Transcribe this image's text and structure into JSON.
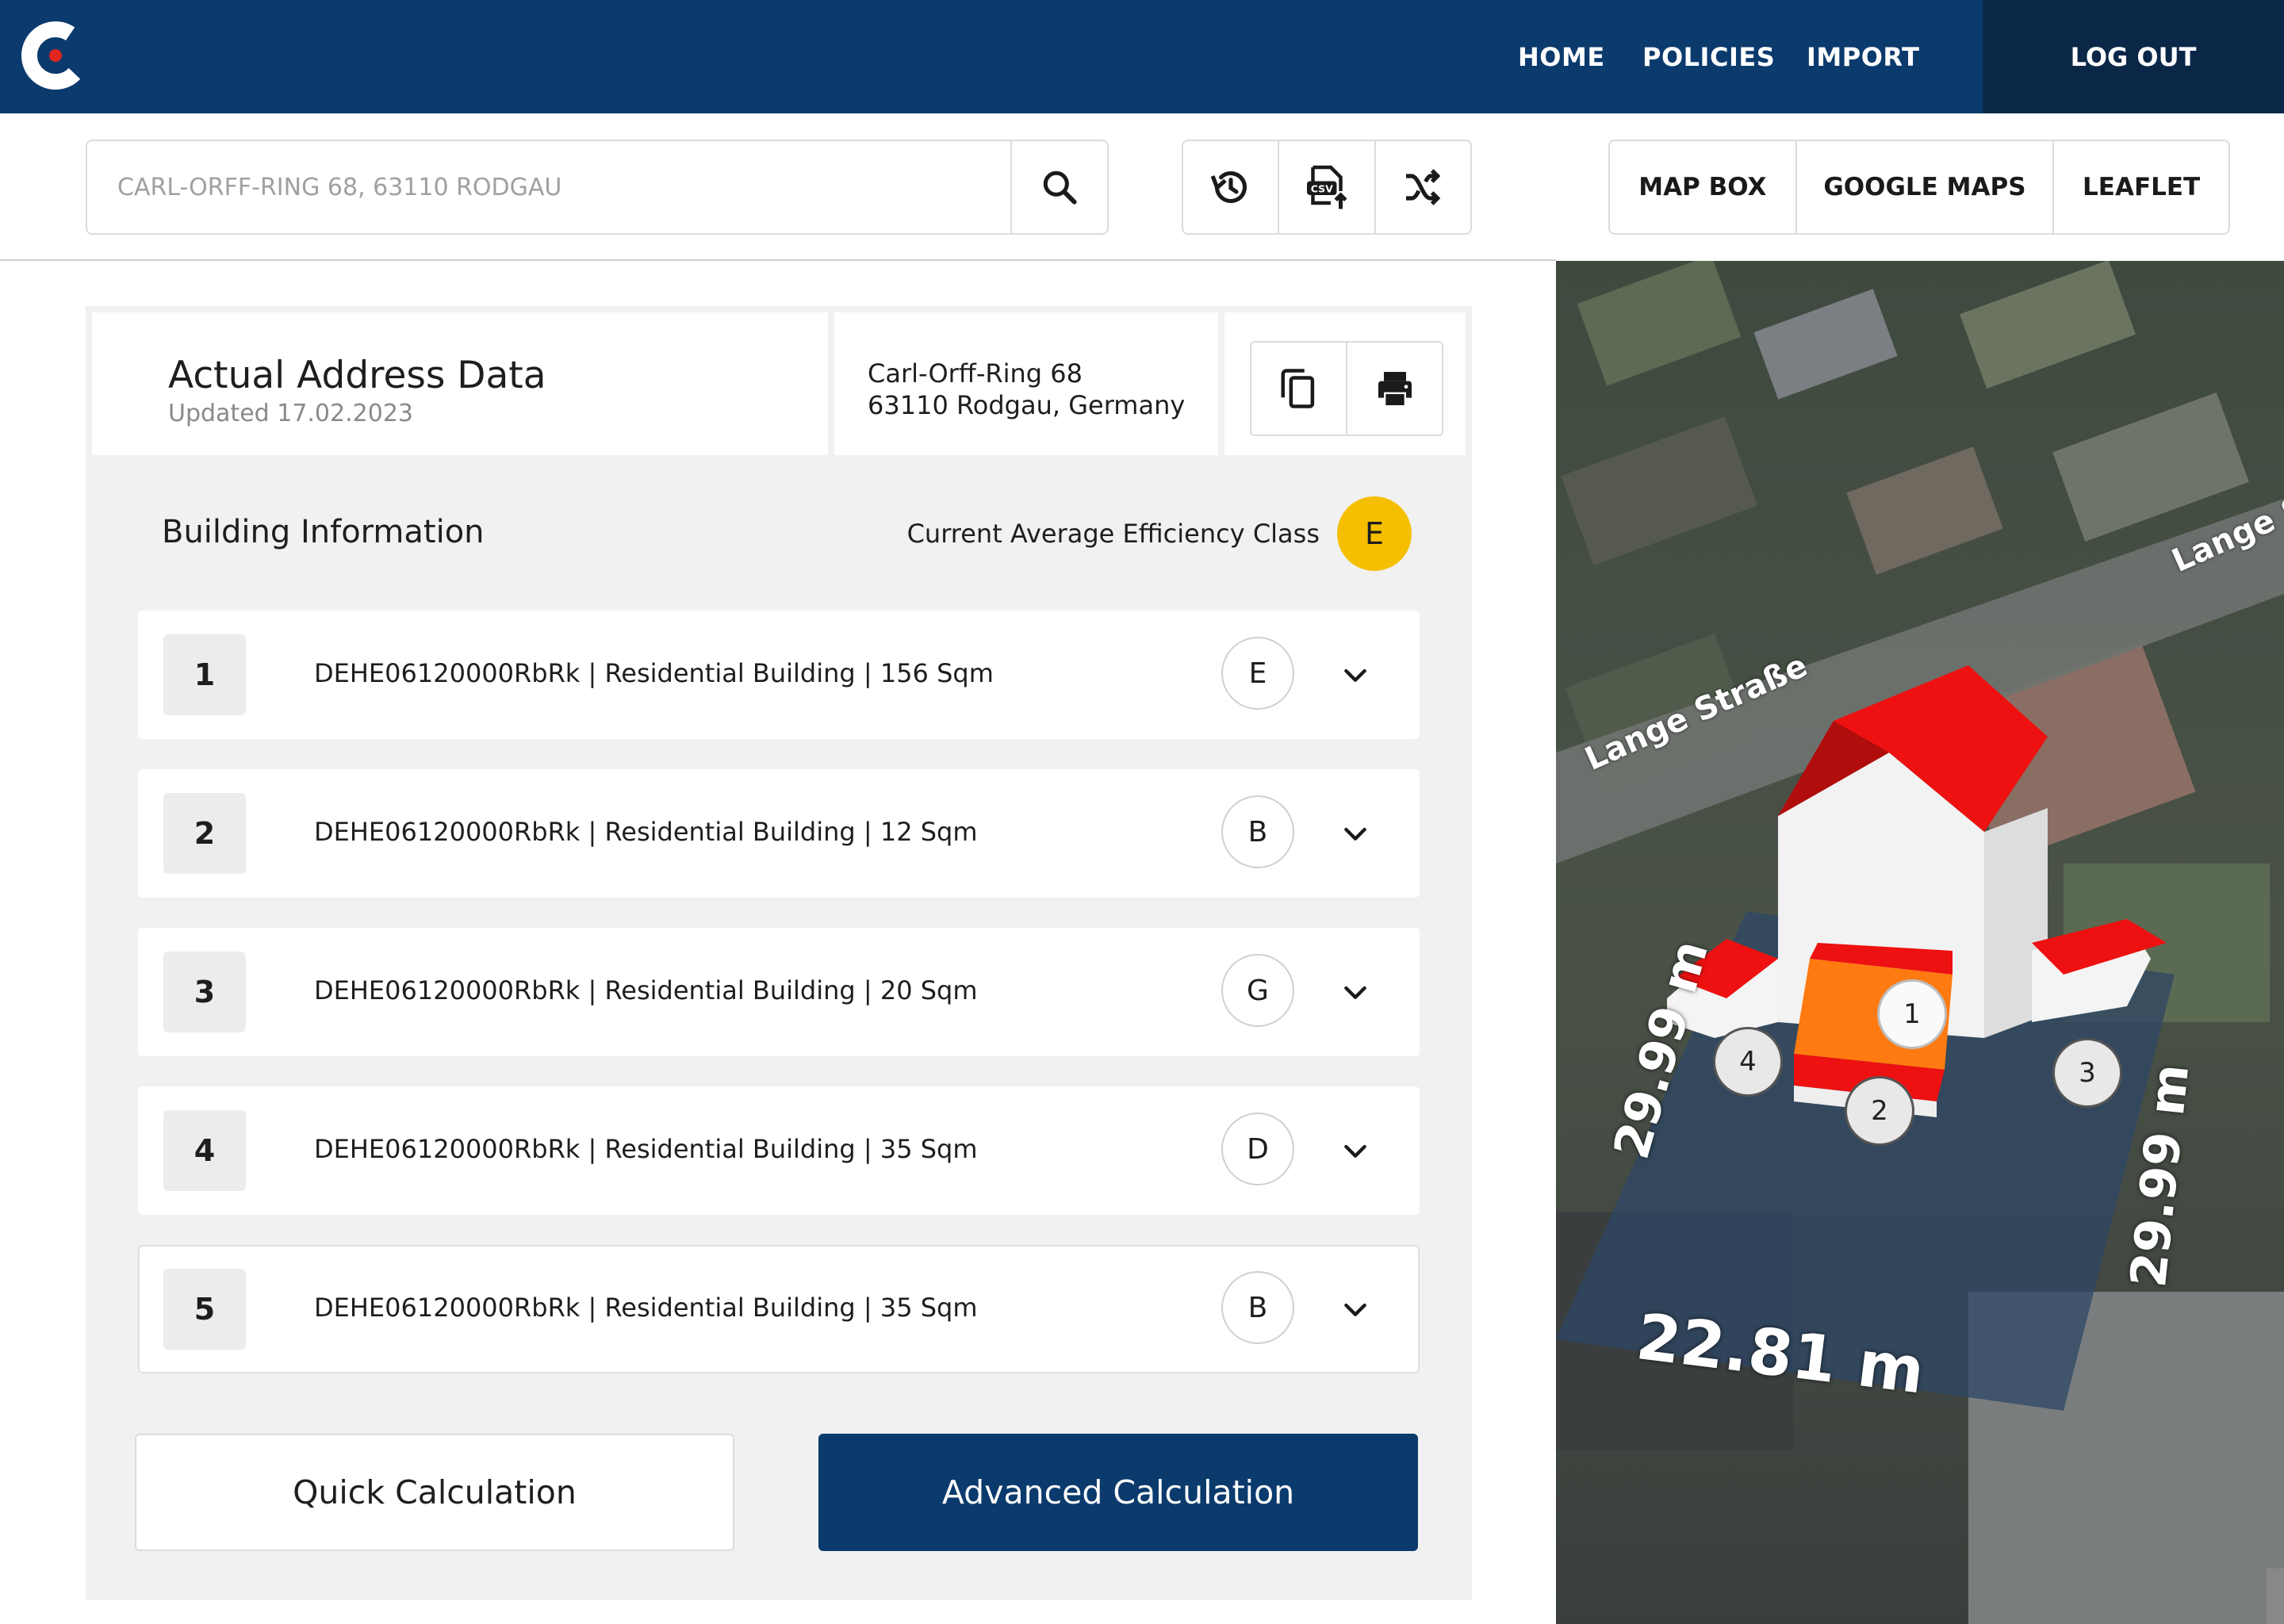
{
  "nav": {
    "links": [
      "HOME",
      "POLICIES",
      "IMPORT"
    ],
    "logout": "LOG OUT",
    "brand_color": "#0b3a6d",
    "logo_accent": "#e3261e"
  },
  "search": {
    "placeholder": "CARL-ORFF-RING 68, 63110 RODGAU",
    "icon": "search-icon"
  },
  "tools": {
    "icons": [
      "history-icon",
      "csv-upload-icon",
      "shuffle-icon"
    ]
  },
  "map_tabs": [
    "MAP BOX",
    "GOOGLE MAPS",
    "LEAFLET"
  ],
  "address_card": {
    "title": "Actual Address Data",
    "updated": "Updated 17.02.2023",
    "address_line1": "Carl-Orff-Ring 68",
    "address_line2": "63110 Rodgau, Germany",
    "icons": [
      "copy-icon",
      "print-icon"
    ]
  },
  "building_info": {
    "title": "Building Information",
    "avg_label": "Current Average Efficiency Class",
    "avg_class": "E",
    "avg_color": "#f5bf00",
    "rows": [
      {
        "num": "1",
        "text": "DEHE06120000RbRk | Residential Building | 156 Sqm",
        "class": "E"
      },
      {
        "num": "2",
        "text": "DEHE06120000RbRk | Residential Building | 12 Sqm",
        "class": "B"
      },
      {
        "num": "3",
        "text": "DEHE06120000RbRk | Residential Building | 20 Sqm",
        "class": "G"
      },
      {
        "num": "4",
        "text": "DEHE06120000RbRk | Residential Building | 35 Sqm",
        "class": "D"
      },
      {
        "num": "5",
        "text": "DEHE06120000RbRk | Residential Building | 35 Sqm",
        "class": "B"
      }
    ]
  },
  "actions": {
    "quick": "Quick Calculation",
    "advanced": "Advanced Calculation"
  },
  "map": {
    "street_1": "Lange Straße",
    "street_2": "Lange S",
    "dim_left": "29.99 m",
    "dim_right": "29.99 m",
    "dim_bottom": "22.81 m",
    "markers": [
      "1",
      "2",
      "3",
      "4"
    ]
  }
}
